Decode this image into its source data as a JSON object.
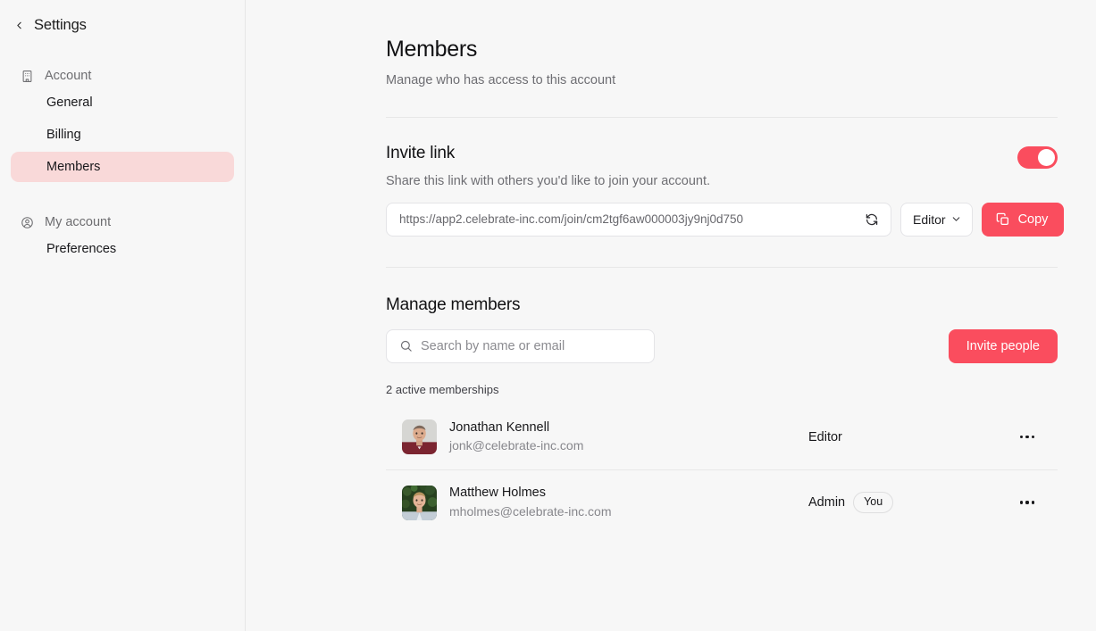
{
  "sidebar": {
    "back_label": "Settings",
    "back_icon": "chevron-left-icon",
    "groups": [
      {
        "label": "Account",
        "icon": "building-icon",
        "items": [
          {
            "label": "General",
            "active": false
          },
          {
            "label": "Billing",
            "active": false
          },
          {
            "label": "Members",
            "active": true
          }
        ]
      },
      {
        "label": "My account",
        "icon": "user-circle-icon",
        "items": [
          {
            "label": "Preferences",
            "active": false
          }
        ]
      }
    ]
  },
  "page": {
    "title": "Members",
    "subtitle": "Manage who has access to this account"
  },
  "invite_link": {
    "title": "Invite link",
    "description": "Share this link with others you'd like to join your account.",
    "url": "https://app2.celebrate-inc.com/join/cm2tgf6aw000003jy9nj0d750",
    "toggle_on": true,
    "refresh_icon": "refresh-icon",
    "role_value": "Editor",
    "role_chevron_icon": "chevron-down-icon",
    "copy_label": "Copy",
    "copy_icon": "copy-icon"
  },
  "manage": {
    "title": "Manage members",
    "search_placeholder": "Search by name or email",
    "search_value": "",
    "search_icon": "search-icon",
    "invite_button_label": "Invite people",
    "count_label": "2 active memberships",
    "members": [
      {
        "name": "Jonathan Kennell",
        "email": "jonk@celebrate-inc.com",
        "role": "Editor",
        "is_you": false,
        "you_label": "",
        "avatar": {
          "bg": "#d8d8d6",
          "shirt": "#7b2430",
          "skin": "#d9a78c",
          "hair": "#7d695c"
        }
      },
      {
        "name": "Matthew Holmes",
        "email": "mholmes@celebrate-inc.com",
        "role": "Admin",
        "is_you": true,
        "you_label": "You",
        "avatar": {
          "bg": "#27401f",
          "shirt": "#c3cdd6",
          "skin": "#e3b497",
          "hair": "#b8935f"
        }
      }
    ],
    "kebab_icon": "more-horizontal-icon"
  },
  "colors": {
    "accent": "#fa4d5e",
    "accent_soft": "#f9d9d9",
    "page_bg": "#f7f7f7",
    "border": "#e4e4e7"
  }
}
